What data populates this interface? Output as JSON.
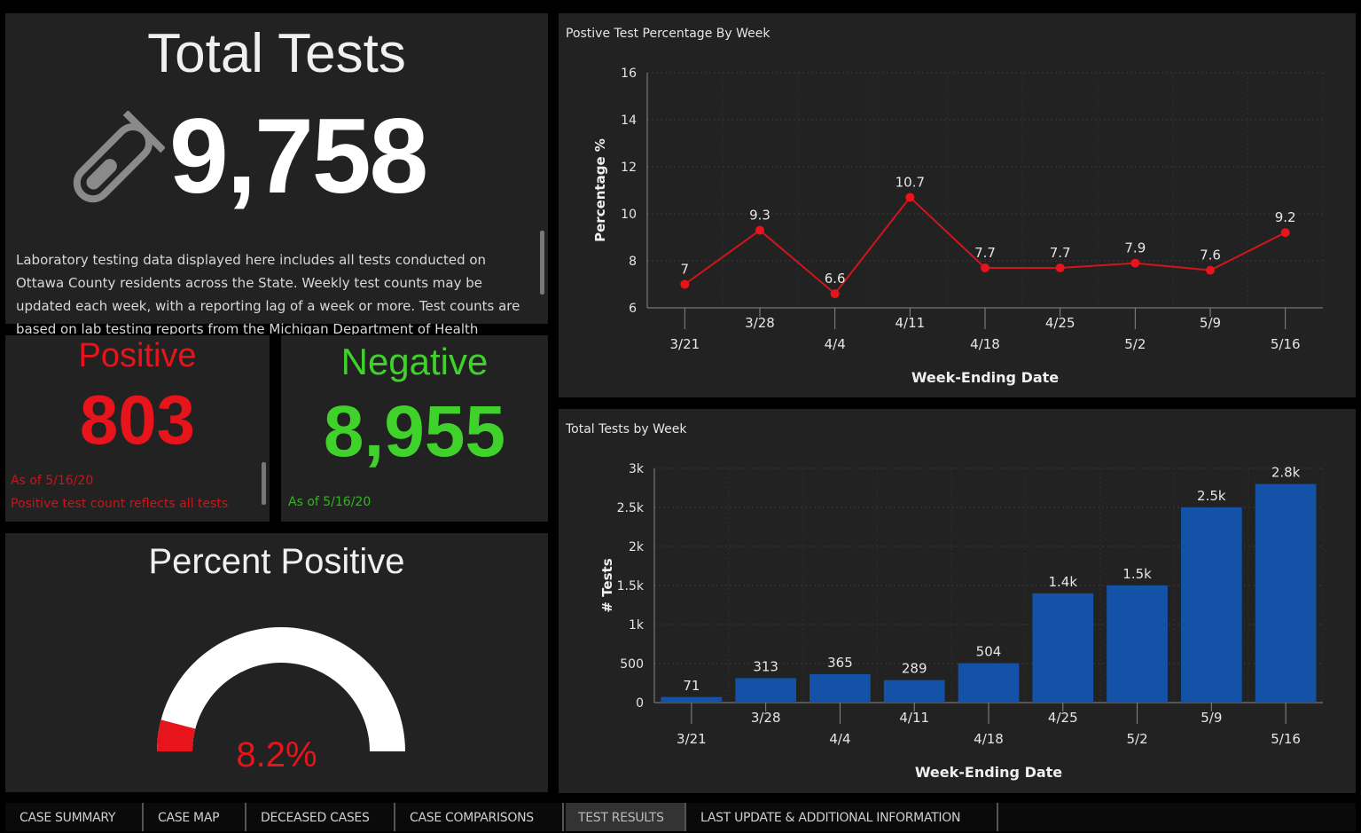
{
  "total_tests": {
    "title": "Total Tests",
    "value": "9,758",
    "icon": "test-tube-icon",
    "description": "Laboratory testing data displayed here includes all tests conducted on Ottawa County residents across the State. Weekly test counts may be updated each week, with a reporting lag of a week or more. Test counts are based on lab testing reports from the Michigan Department of Health"
  },
  "positive": {
    "title": "Positive",
    "value": "803",
    "note1": "As of 5/16/20",
    "note2": "Positive test count reflects all tests",
    "color": "#e8141b"
  },
  "negative": {
    "title": "Negative",
    "value": "8,955",
    "note1": "As of 5/16/20",
    "color": "#3fd22a"
  },
  "percent_positive": {
    "title": "Percent Positive",
    "value_text": "8.2%",
    "fraction": 0.082
  },
  "chart_data": [
    {
      "type": "line",
      "title": "Postive Test Percentage By Week",
      "xlabel": "Week-Ending Date",
      "ylabel": "Percentage %",
      "categories": [
        "3/21",
        "3/28",
        "4/4",
        "4/11",
        "4/18",
        "4/25",
        "5/2",
        "5/9",
        "5/16"
      ],
      "values": [
        7,
        9.3,
        6.6,
        10.7,
        7.7,
        7.7,
        7.9,
        7.6,
        9.2
      ],
      "labels": [
        "7",
        "9.3",
        "6.6",
        "10.7",
        "7.7",
        "7.7",
        "7.9",
        "7.6",
        "9.2"
      ],
      "yticks": [
        "6",
        "8",
        "10",
        "12",
        "14",
        "16"
      ],
      "ylim": [
        6,
        16
      ],
      "color": "#d0161b",
      "grid": true
    },
    {
      "type": "bar",
      "title": "Total Tests by Week",
      "xlabel": "Week-Ending Date",
      "ylabel": "# Tests",
      "categories": [
        "3/21",
        "3/28",
        "4/4",
        "4/11",
        "4/18",
        "4/25",
        "5/2",
        "5/9",
        "5/16"
      ],
      "values": [
        71,
        313,
        365,
        289,
        504,
        1400,
        1500,
        2500,
        2800
      ],
      "labels": [
        "71",
        "313",
        "365",
        "289",
        "504",
        "1.4k",
        "1.5k",
        "2.5k",
        "2.8k"
      ],
      "yticks": [
        "0",
        "500",
        "1k",
        "1.5k",
        "2k",
        "2.5k",
        "3k"
      ],
      "ylim": [
        0,
        3000
      ],
      "color": "#1452a8",
      "grid": true
    }
  ],
  "tabs": [
    {
      "label": "CASE SUMMARY"
    },
    {
      "label": "CASE MAP"
    },
    {
      "label": "DECEASED CASES"
    },
    {
      "label": "CASE COMPARISONS"
    },
    {
      "label": "TEST RESULTS"
    },
    {
      "label": "LAST UPDATE & ADDITIONAL INFORMATION"
    }
  ]
}
